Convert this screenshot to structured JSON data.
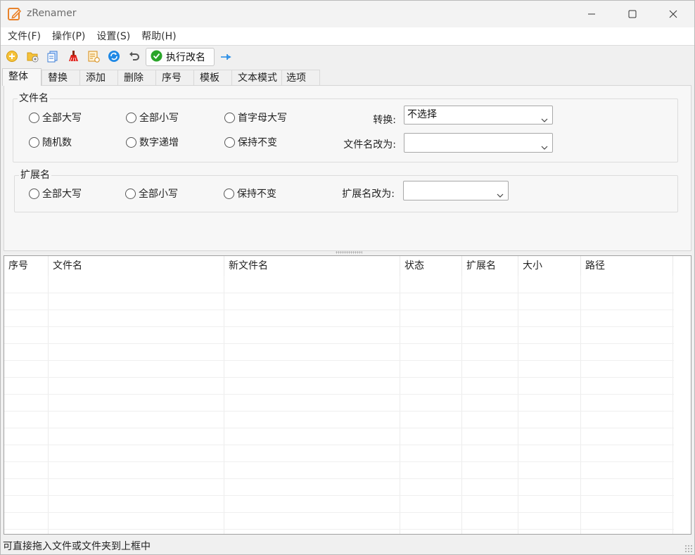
{
  "window": {
    "title": "zRenamer"
  },
  "menu": [
    "文件(F)",
    "操作(P)",
    "设置(S)",
    "帮助(H)"
  ],
  "toolbar": {
    "icons": [
      "add-file-icon",
      "add-folder-icon",
      "copy-icon",
      "clear-icon",
      "edit-list-icon",
      "refresh-icon",
      "undo-icon"
    ],
    "execute_label": "执行改名",
    "pin_icon": "pin-icon"
  },
  "tabs": [
    "整体",
    "替换",
    "添加",
    "删除",
    "序号",
    "模板",
    "文本模式",
    "选项"
  ],
  "filename_group": {
    "title": "文件名",
    "options": [
      "全部大写",
      "全部小写",
      "首字母大写",
      "随机数",
      "数字递增",
      "保持不变"
    ],
    "convert_label": "转换:",
    "convert_value": "不选择",
    "rename_label": "文件名改为:",
    "rename_value": ""
  },
  "extension_group": {
    "title": "扩展名",
    "options": [
      "全部大写",
      "全部小写",
      "保持不变"
    ],
    "rename_label": "扩展名改为:",
    "rename_value": ""
  },
  "table": {
    "columns": [
      "序号",
      "文件名",
      "新文件名",
      "状态",
      "扩展名",
      "大小",
      "路径"
    ]
  },
  "status": {
    "text": "可直接拖入文件或文件夹到上框中"
  },
  "colors": {
    "accent_orange": "#e8822a",
    "exec_green": "#2aa52a",
    "refresh_blue": "#1e88e5"
  }
}
